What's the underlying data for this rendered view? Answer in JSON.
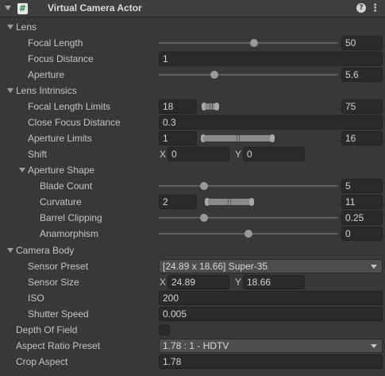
{
  "header": {
    "title": "Virtual Camera Actor",
    "component_icon": "#",
    "help_glyph": "?",
    "menu_glyph": "⋮"
  },
  "lens": {
    "label": "Lens",
    "focal_length": {
      "label": "Focal Length",
      "value": "50",
      "slider_fraction": 0.53
    },
    "focus_distance": {
      "label": "Focus Distance",
      "value": "1"
    },
    "aperture": {
      "label": "Aperture",
      "value": "5.6",
      "slider_fraction": 0.31
    }
  },
  "lens_intrinsics": {
    "label": "Lens Intrinsics",
    "focal_length_limits": {
      "label": "Focal Length Limits",
      "min": "18",
      "max": "75"
    },
    "close_focus_distance": {
      "label": "Close Focus Distance",
      "value": "0.3"
    },
    "aperture_limits": {
      "label": "Aperture Limits",
      "min": "1",
      "max": "16"
    },
    "shift": {
      "label": "Shift",
      "x_label": "X",
      "x": "0",
      "y_label": "Y",
      "y": "0"
    },
    "aperture_shape": {
      "label": "Aperture Shape",
      "blade_count": {
        "label": "Blade Count",
        "value": "5",
        "slider_fraction": 0.25
      },
      "curvature": {
        "label": "Curvature",
        "min": "2",
        "max": "11"
      },
      "barrel_clipping": {
        "label": "Barrel Clipping",
        "value": "0.25",
        "slider_fraction": 0.25
      },
      "anamorphism": {
        "label": "Anamorphism",
        "value": "0",
        "slider_fraction": 0.5
      }
    }
  },
  "camera_body": {
    "label": "Camera Body",
    "sensor_preset": {
      "label": "Sensor Preset",
      "value": "[24.89 x 18.66] Super-35"
    },
    "sensor_size": {
      "label": "Sensor Size",
      "x_label": "X",
      "x": "24.89",
      "y_label": "Y",
      "y": "18.66"
    },
    "iso": {
      "label": "ISO",
      "value": "200"
    },
    "shutter_speed": {
      "label": "Shutter Speed",
      "value": "0.005"
    }
  },
  "depth_of_field": {
    "label": "Depth Of Field",
    "checked": false
  },
  "aspect_ratio_preset": {
    "label": "Aspect Ratio Preset",
    "value": "1.78 : 1 - HDTV"
  },
  "crop_aspect": {
    "label": "Crop Aspect",
    "value": "1.78"
  }
}
